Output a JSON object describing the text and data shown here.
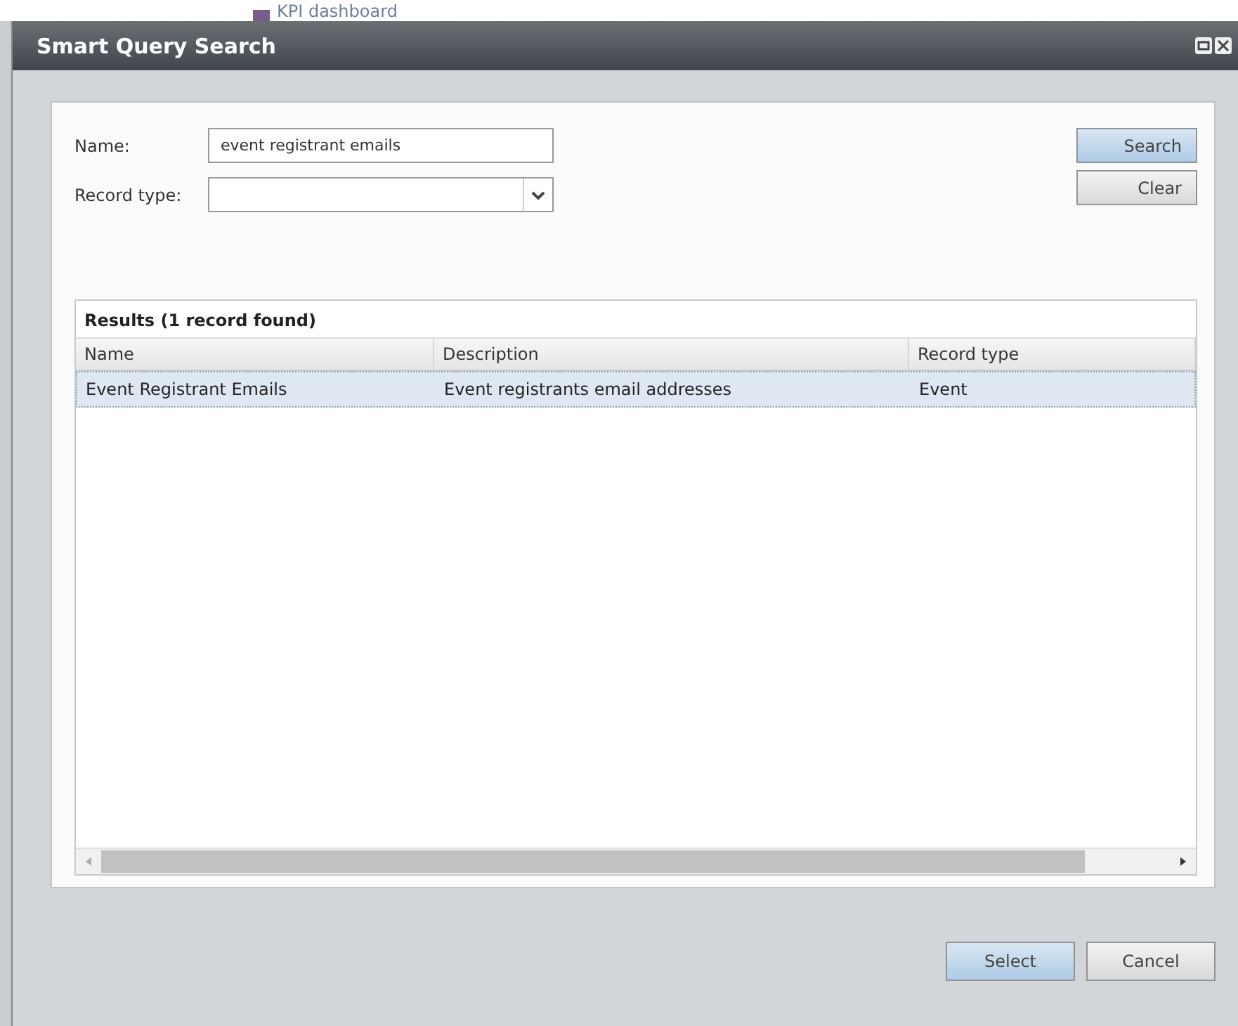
{
  "background": {
    "item": "KPI dashboard"
  },
  "window": {
    "title": "Smart Query Search"
  },
  "form": {
    "fields": [
      {
        "label": "Name:",
        "kind": "text",
        "value": "event registrant emails"
      },
      {
        "label": "Record type:",
        "kind": "dropdown"
      }
    ],
    "buttons": [
      {
        "label": "Search",
        "kind": "primary"
      },
      {
        "label": "Clear",
        "kind": "secondary"
      }
    ]
  },
  "results": {
    "title": "Results (1 record found)",
    "columns": [
      "Name",
      "Description",
      "Record type"
    ],
    "rows": [
      {
        "cells": [
          "Event Registrant Emails",
          "Event registrants email addresses",
          "Event"
        ],
        "selected": true
      }
    ]
  },
  "footer_buttons": [
    {
      "label": "Select",
      "kind": "primary"
    },
    {
      "label": "Cancel",
      "kind": "secondary"
    }
  ]
}
